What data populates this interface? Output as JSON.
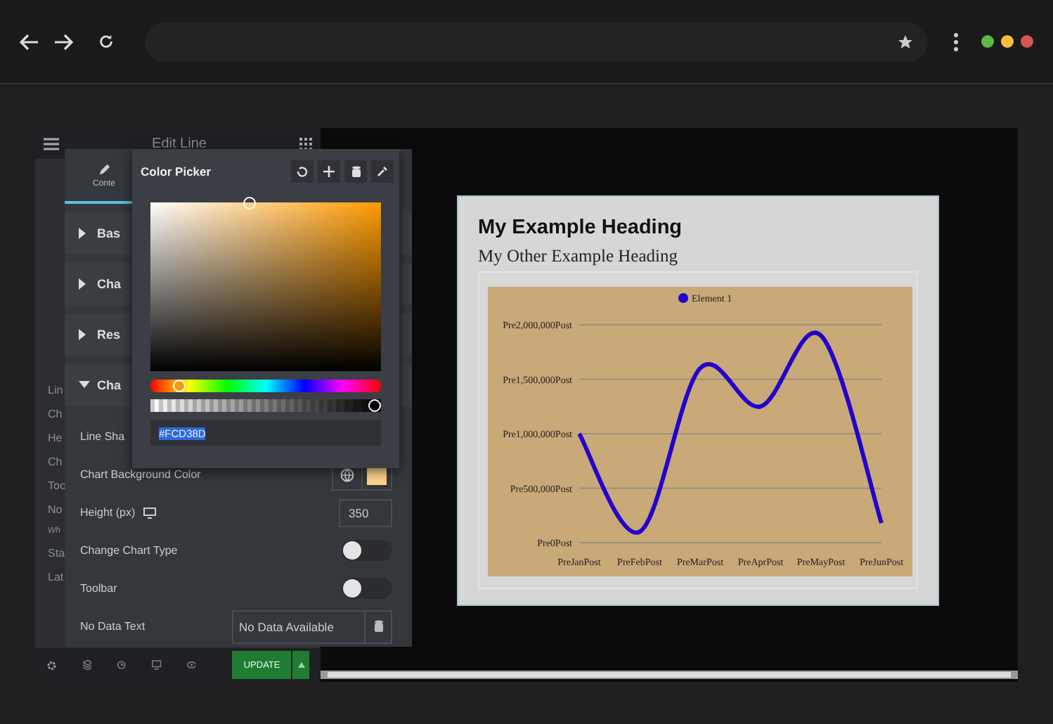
{
  "editor": {
    "title": "Edit Line",
    "sidebar_items": [
      {
        "label": "Lin",
        "kind": "label"
      },
      {
        "label": "Ch",
        "kind": "label"
      },
      {
        "label": "He",
        "kind": "label"
      },
      {
        "label": "Ch",
        "kind": "label"
      },
      {
        "label": "Too",
        "kind": "label"
      },
      {
        "label": "No",
        "kind": "label"
      },
      {
        "label": "Wh",
        "kind": "note"
      },
      {
        "label": "Sta",
        "kind": "label"
      },
      {
        "label": "Lat",
        "kind": "label"
      }
    ],
    "update_button": "UPDATE"
  },
  "panel": {
    "tab": {
      "label": "Conte",
      "selected": true
    },
    "sections": [
      {
        "label": "Bas",
        "expanded": false
      },
      {
        "label": "Cha",
        "expanded": false
      },
      {
        "label": "Res",
        "expanded": false
      },
      {
        "label": "Cha",
        "expanded": true
      }
    ],
    "controls": [
      {
        "kind": "label",
        "label": "Line Sha"
      },
      {
        "kind": "color",
        "label": "Chart Background Color"
      },
      {
        "kind": "number",
        "label": "Height (px)",
        "value": "350"
      },
      {
        "kind": "toggle",
        "label": "Change Chart Type",
        "on": false
      },
      {
        "kind": "toggle",
        "label": "Toolbar",
        "on": false
      },
      {
        "kind": "select",
        "label": "No Data Text",
        "value": "No Data Available"
      }
    ]
  },
  "color_picker": {
    "title": "Color Picker",
    "hex": "#FCD38D",
    "hue": {
      "level": 0.1
    },
    "alpha": {
      "level": 1
    }
  },
  "preview": {
    "heading": "My Example Heading",
    "subheading": "My Other Example Heading",
    "chart": {
      "legend": "Element 1",
      "y_axis_labels": [
        "Pre2,000,000Post",
        "Pre1,500,000Post",
        "Pre1,000,000Post",
        "Pre500,000Post",
        "Pre0Post"
      ],
      "x_axis_labels": [
        "PreJanPost",
        "PreFebPost",
        "PreMarPost",
        "PreAprPost",
        "PreMayPost",
        "PreJunPost"
      ]
    }
  }
}
